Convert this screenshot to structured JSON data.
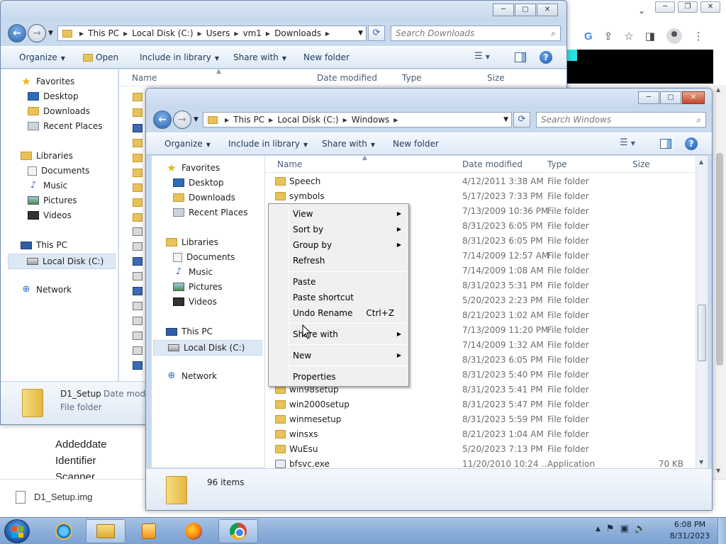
{
  "background": {
    "page_labels": [
      "Addeddate",
      "Identifier",
      "Scanner"
    ],
    "download_item": "D1_Setup.img"
  },
  "back_window": {
    "address": {
      "segments": [
        "This PC",
        "Local Disk (C:)",
        "Users",
        "vm1",
        "Downloads"
      ]
    },
    "search_placeholder": "Search Downloads",
    "toolbar": {
      "organize": "Organize",
      "open": "Open",
      "include": "Include in library",
      "share": "Share with",
      "new_folder": "New folder"
    },
    "columns": {
      "name": "Name",
      "date": "Date modified",
      "type": "Type",
      "size": "Size"
    },
    "nav": {
      "favorites": "Favorites",
      "desktop": "Desktop",
      "downloads": "Downloads",
      "recent": "Recent Places",
      "libraries": "Libraries",
      "documents": "Documents",
      "music": "Music",
      "pictures": "Pictures",
      "videos": "Videos",
      "thispc": "This PC",
      "localdisk": "Local Disk (C:)",
      "network": "Network"
    },
    "details": {
      "name": "D1_Setup",
      "date_label": "Date modif",
      "kind": "File folder"
    }
  },
  "front_window": {
    "address": {
      "segments": [
        "This PC",
        "Local Disk (C:)",
        "Windows"
      ]
    },
    "search_placeholder": "Search Windows",
    "toolbar": {
      "organize": "Organize",
      "include": "Include in library",
      "share": "Share with",
      "new_folder": "New folder"
    },
    "columns": {
      "name": "Name",
      "date": "Date modified",
      "type": "Type",
      "size": "Size"
    },
    "nav": {
      "favorites": "Favorites",
      "desktop": "Desktop",
      "downloads": "Downloads",
      "recent": "Recent Places",
      "libraries": "Libraries",
      "documents": "Documents",
      "music": "Music",
      "pictures": "Pictures",
      "videos": "Videos",
      "thispc": "This PC",
      "localdisk": "Local Disk (C:)",
      "network": "Network"
    },
    "files": [
      {
        "name": "Speech",
        "date": "4/12/2011 3:38 AM",
        "type": "File folder",
        "size": ""
      },
      {
        "name": "symbols",
        "date": "5/17/2023 7:33 PM",
        "type": "File folder",
        "size": ""
      },
      {
        "name": "",
        "date": "7/13/2009 10:36 PM",
        "type": "File folder",
        "size": ""
      },
      {
        "name": "",
        "date": "8/31/2023 6:05 PM",
        "type": "File folder",
        "size": ""
      },
      {
        "name": "",
        "date": "8/31/2023 6:05 PM",
        "type": "File folder",
        "size": ""
      },
      {
        "name": "",
        "date": "7/14/2009 12:57 AM",
        "type": "File folder",
        "size": ""
      },
      {
        "name": "",
        "date": "7/14/2009 1:08 AM",
        "type": "File folder",
        "size": ""
      },
      {
        "name": "",
        "date": "8/31/2023 5:31 PM",
        "type": "File folder",
        "size": ""
      },
      {
        "name": "",
        "date": "5/20/2023 2:23 PM",
        "type": "File folder",
        "size": ""
      },
      {
        "name": "",
        "date": "8/21/2023 1:02 AM",
        "type": "File folder",
        "size": ""
      },
      {
        "name": "",
        "date": "7/13/2009 11:20 PM",
        "type": "File folder",
        "size": ""
      },
      {
        "name": "",
        "date": "7/14/2009 1:32 AM",
        "type": "File folder",
        "size": ""
      },
      {
        "name": "",
        "date": "8/31/2023 6:05 PM",
        "type": "File folder",
        "size": ""
      },
      {
        "name": "",
        "date": "8/31/2023 5:40 PM",
        "type": "File folder",
        "size": ""
      },
      {
        "name": "win98setup",
        "date": "8/31/2023 5:41 PM",
        "type": "File folder",
        "size": ""
      },
      {
        "name": "win2000setup",
        "date": "8/31/2023 5:47 PM",
        "type": "File folder",
        "size": ""
      },
      {
        "name": "winmesetup",
        "date": "8/31/2023 5:59 PM",
        "type": "File folder",
        "size": ""
      },
      {
        "name": "winsxs",
        "date": "8/21/2023 1:04 AM",
        "type": "File folder",
        "size": ""
      },
      {
        "name": "WuEsu",
        "date": "5/20/2023 7:13 PM",
        "type": "File folder",
        "size": ""
      },
      {
        "name": "bfsvc.exe",
        "date": "11/20/2010 10:24 ...",
        "type": "Application",
        "size": "70 KB"
      }
    ],
    "status": {
      "count": "96 items"
    }
  },
  "context_menu": {
    "items": [
      {
        "label": "View",
        "shortcut": "",
        "submenu": true
      },
      {
        "label": "Sort by",
        "shortcut": "",
        "submenu": true
      },
      {
        "label": "Group by",
        "shortcut": "",
        "submenu": true
      },
      {
        "label": "Refresh",
        "shortcut": "",
        "submenu": false
      },
      {
        "label": "Paste",
        "shortcut": "",
        "submenu": false
      },
      {
        "label": "Paste shortcut",
        "shortcut": "",
        "submenu": false
      },
      {
        "label": "Undo Rename",
        "shortcut": "Ctrl+Z",
        "submenu": false
      },
      {
        "label": "Share with",
        "shortcut": "",
        "submenu": true
      },
      {
        "label": "New",
        "shortcut": "",
        "submenu": true
      },
      {
        "label": "Properties",
        "shortcut": "",
        "submenu": false
      }
    ]
  },
  "taskbar": {
    "clock_time": "6:08 PM",
    "clock_date": "8/31/2023"
  }
}
